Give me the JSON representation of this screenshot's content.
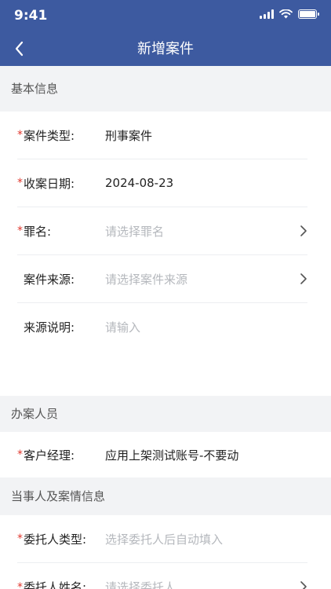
{
  "status_bar": {
    "time": "9:41"
  },
  "nav": {
    "title": "新增案件"
  },
  "sections": {
    "basic": "基本信息",
    "staff": "办案人员",
    "parties": "当事人及案情信息"
  },
  "fields": {
    "case_type": {
      "label": "案件类型:",
      "value": "刑事案件"
    },
    "filing_date": {
      "label": "收案日期:",
      "value": "2024-08-23"
    },
    "charge": {
      "label": "罪名:",
      "placeholder": "请选择罪名"
    },
    "case_source": {
      "label": "案件来源:",
      "placeholder": "请选择案件来源"
    },
    "source_desc": {
      "label": "来源说明:",
      "placeholder": "请输入"
    },
    "account_manager": {
      "label": "客户经理:",
      "value": "应用上架测试账号-不要动"
    },
    "client_type": {
      "label": "委托人类型:",
      "placeholder": "选择委托人后自动填入"
    },
    "client_name": {
      "label": "委托人姓名:",
      "placeholder": "请选择委托人"
    }
  },
  "required_mark": "*",
  "icons": [
    "back-chevron-icon",
    "signal-icon",
    "wifi-icon",
    "battery-icon",
    "chevron-right-icon"
  ]
}
